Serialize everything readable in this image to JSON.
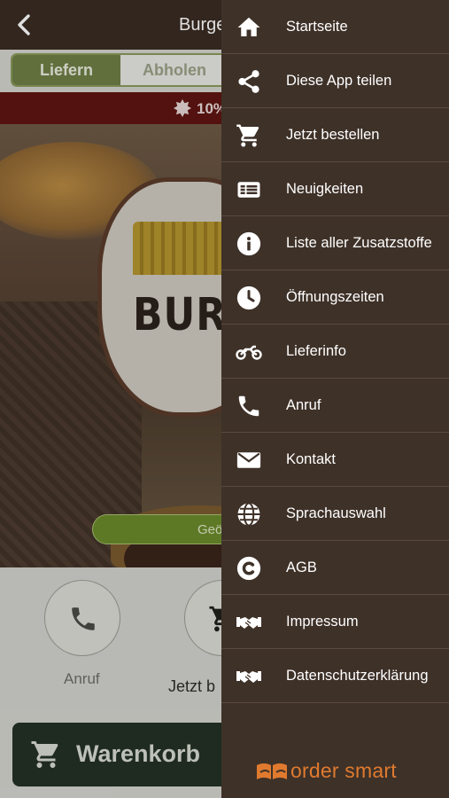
{
  "app": {
    "title": "Burge",
    "tabs": [
      {
        "label": "Liefern",
        "active": true
      },
      {
        "label": "Abholen",
        "active": false
      }
    ],
    "promo_text": "10%",
    "logo_text": "BURGE",
    "cta_label": "Geö",
    "actions": [
      {
        "label": "Anruf",
        "icon": "phone-icon"
      },
      {
        "label": "Jetzt b",
        "icon": "cart-icon"
      }
    ],
    "cart_button_label": "Warenkorb"
  },
  "drawer": {
    "items": [
      {
        "label": "Startseite",
        "icon": "home-icon"
      },
      {
        "label": "Diese App teilen",
        "icon": "share-icon"
      },
      {
        "label": "Jetzt bestellen",
        "icon": "cart-icon"
      },
      {
        "label": "Neuigkeiten",
        "icon": "news-icon"
      },
      {
        "label": "Liste aller Zusatzstoffe",
        "icon": "info-icon"
      },
      {
        "label": "Öffnungszeiten",
        "icon": "clock-icon"
      },
      {
        "label": "Lieferinfo",
        "icon": "motorbike-icon"
      },
      {
        "label": "Anruf",
        "icon": "phone-icon"
      },
      {
        "label": "Kontakt",
        "icon": "envelope-icon"
      },
      {
        "label": "Sprachauswahl",
        "icon": "globe-icon"
      },
      {
        "label": "AGB",
        "icon": "copyright-icon"
      },
      {
        "label": "Impressum",
        "icon": "handshake-icon"
      },
      {
        "label": "Datenschutzerklärung",
        "icon": "handshake-icon"
      }
    ],
    "brand": "order smart"
  },
  "colors": {
    "drawer_bg": "#3e3128",
    "topbar_bg": "#3a2c24",
    "accent_green": "#6f7f46",
    "promo_red": "#5f1512",
    "brand_orange": "#e07a2f"
  }
}
